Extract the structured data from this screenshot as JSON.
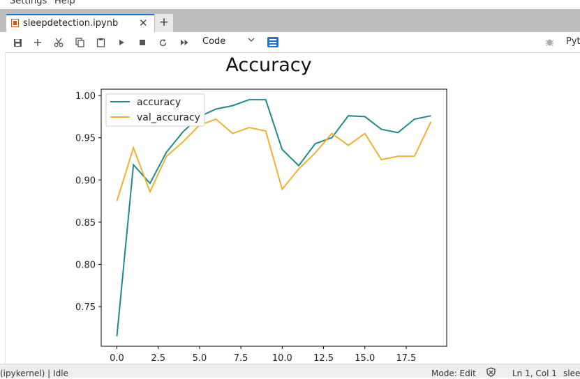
{
  "menu": {
    "settings_label": "Settings",
    "help_label": "Help"
  },
  "tab": {
    "title": "sleepdetection.ipynb",
    "close_glyph": "✕",
    "new_tab_glyph": "+"
  },
  "toolbar": {
    "cell_type": "Code",
    "kernel_name": "Pyt",
    "icons": [
      "save-icon",
      "add-cell-icon",
      "cut-icon",
      "copy-icon",
      "paste-icon",
      "run-icon",
      "stop-icon",
      "restart-icon",
      "run-all-icon",
      "command-palette-icon",
      "bug-icon"
    ]
  },
  "status": {
    "kernel_status": "(ipykernel) | Idle",
    "mode": "Mode: Edit",
    "position": "Ln 1, Col 1",
    "file": "slee"
  },
  "colors": {
    "accuracy": "#1f8a8a",
    "val_accuracy": "#f0b030",
    "accent": "#1976d2"
  },
  "chart_data": {
    "type": "line",
    "title": "Accuracy",
    "xlabel": "",
    "ylabel": "",
    "xlim": [
      -0.95,
      19.95
    ],
    "ylim": [
      0.703,
      1.0075
    ],
    "xticks": [
      0.0,
      2.5,
      5.0,
      7.5,
      10.0,
      12.5,
      15.0,
      17.5
    ],
    "yticks": [
      0.75,
      0.8,
      0.85,
      0.9,
      0.95,
      1.0
    ],
    "x": [
      0,
      1,
      2,
      3,
      4,
      5,
      6,
      7,
      8,
      9,
      10,
      11,
      12,
      13,
      14,
      15,
      16,
      17,
      18,
      19
    ],
    "legend_position": "top-left",
    "grid": false,
    "series": [
      {
        "name": "accuracy",
        "values": [
          0.715,
          0.918,
          0.896,
          0.933,
          0.957,
          0.975,
          0.984,
          0.988,
          0.995,
          0.995,
          0.936,
          0.917,
          0.943,
          0.95,
          0.976,
          0.975,
          0.96,
          0.956,
          0.972,
          0.976
        ]
      },
      {
        "name": "val_accuracy",
        "values": [
          0.875,
          0.938,
          0.886,
          0.928,
          0.945,
          0.965,
          0.972,
          0.955,
          0.962,
          0.958,
          0.889,
          0.913,
          0.932,
          0.955,
          0.941,
          0.955,
          0.924,
          0.928,
          0.928,
          0.969
        ]
      }
    ]
  }
}
